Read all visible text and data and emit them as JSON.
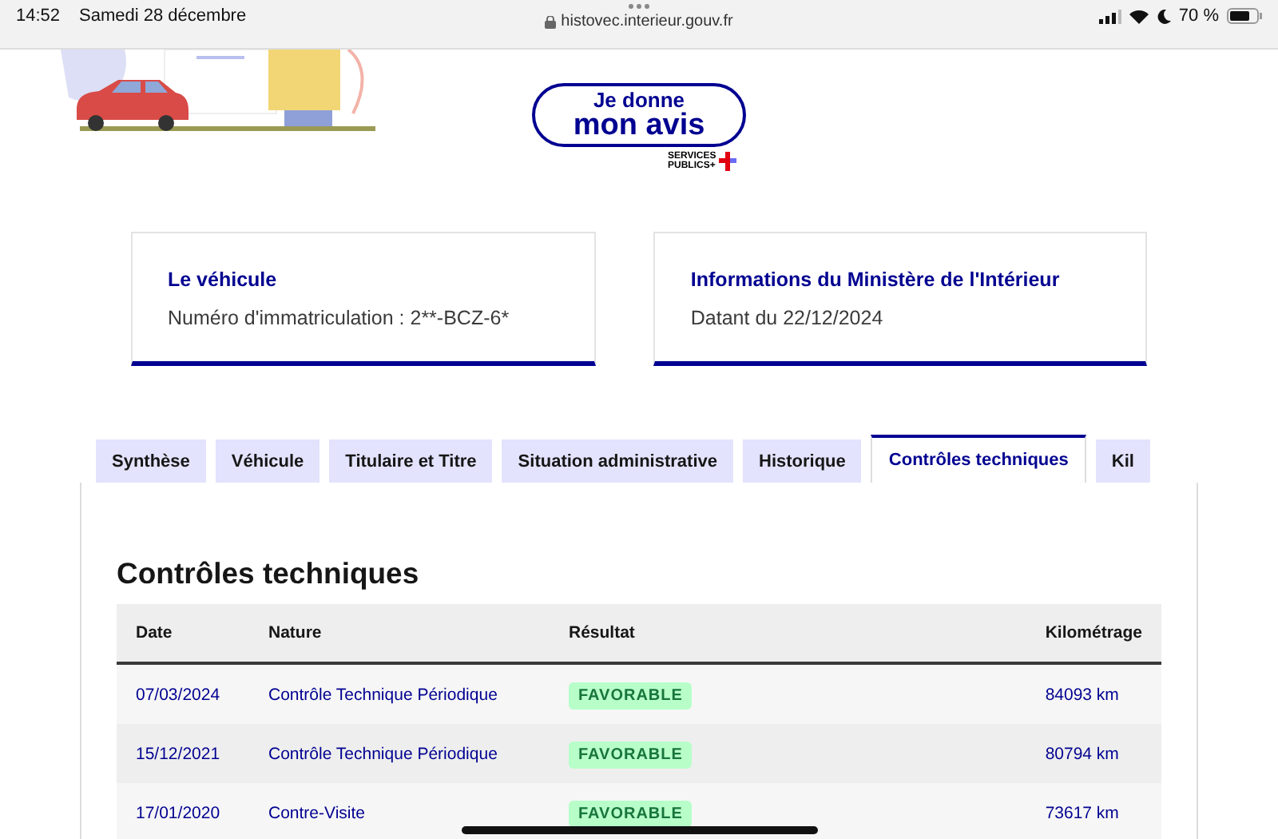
{
  "status_bar": {
    "time": "14:52",
    "date": "Samedi 28 décembre",
    "url": "histovec.interieur.gouv.fr",
    "battery": "70 %"
  },
  "feedback": {
    "line1": "Je donne",
    "line2": "mon avis",
    "brand_line1": "SERVICES",
    "brand_line2": "PUBLICS+"
  },
  "cards": [
    {
      "title": "Le véhicule",
      "text": "Numéro d'immatriculation : 2**-BCZ-6*"
    },
    {
      "title": "Informations du Ministère de l'Intérieur",
      "text": "Datant du 22/12/2024"
    }
  ],
  "tabs": [
    {
      "label": "Synthèse",
      "selected": false
    },
    {
      "label": "Véhicule",
      "selected": false
    },
    {
      "label": "Titulaire et Titre",
      "selected": false
    },
    {
      "label": "Situation administrative",
      "selected": false
    },
    {
      "label": "Historique",
      "selected": false
    },
    {
      "label": "Contrôles techniques",
      "selected": true
    },
    {
      "label": "Kil",
      "selected": false
    }
  ],
  "section_title": "Contrôles techniques",
  "table": {
    "columns": [
      "Date",
      "Nature",
      "Résultat",
      "Kilométrage"
    ],
    "rows": [
      {
        "date": "07/03/2024",
        "nature": "Contrôle Technique Périodique",
        "result": "FAVORABLE",
        "km": "84093 km"
      },
      {
        "date": "15/12/2021",
        "nature": "Contrôle Technique Périodique",
        "result": "FAVORABLE",
        "km": "80794 km"
      },
      {
        "date": "17/01/2020",
        "nature": "Contre-Visite",
        "result": "FAVORABLE",
        "km": "73617 km"
      }
    ]
  }
}
